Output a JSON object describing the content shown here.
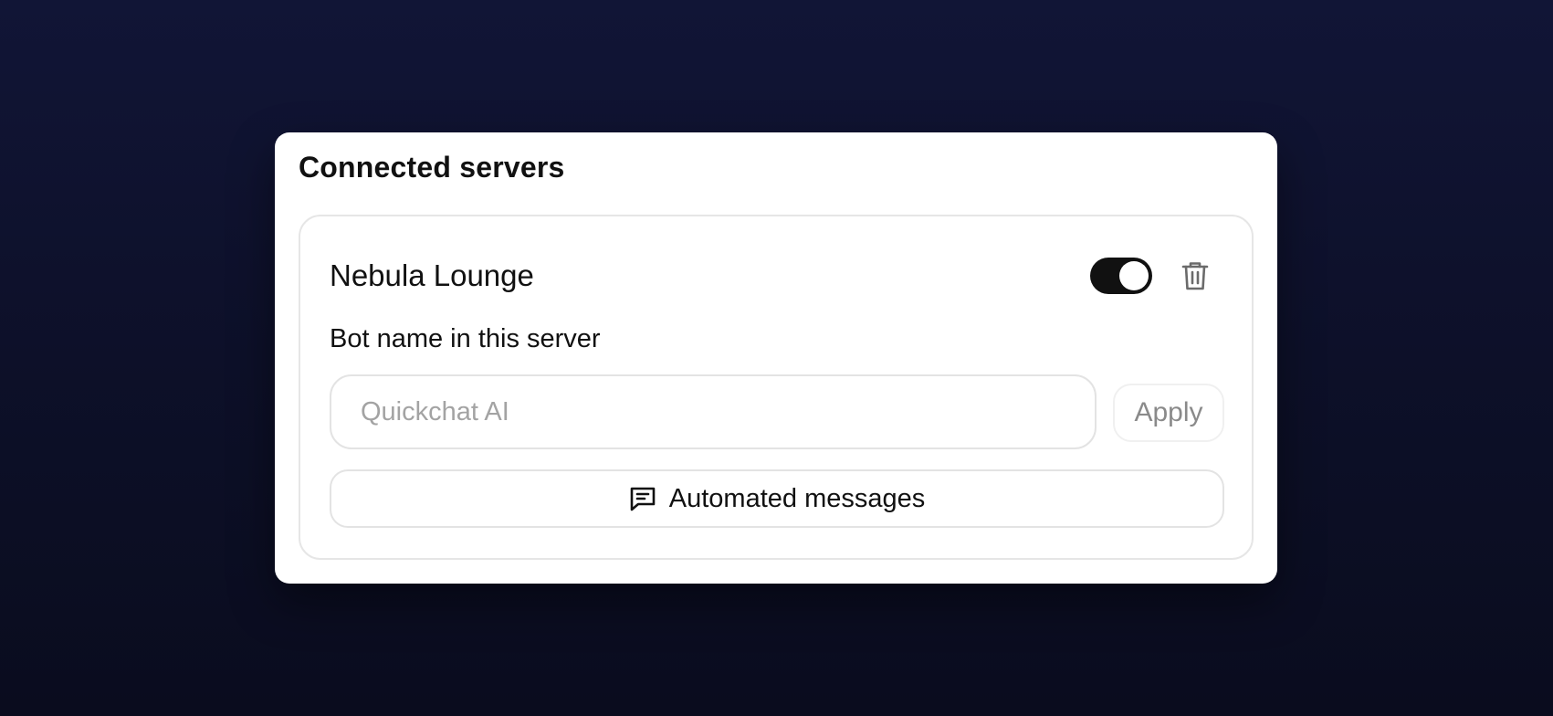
{
  "panel": {
    "title": "Connected servers"
  },
  "server": {
    "name": "Nebula Lounge",
    "enabled": true,
    "toggle_icon": "toggle-on",
    "delete_icon": "trash-icon",
    "bot_name_label": "Bot name in this server",
    "bot_name_value": "",
    "bot_name_placeholder": "Quickchat AI",
    "apply_label": "Apply",
    "automated_messages_label": "Automated messages",
    "automated_messages_icon": "message-square-icon"
  },
  "colors": {
    "background": "#0d1029",
    "panel": "#ffffff",
    "toggle_on": "#111111",
    "placeholder": "#a3a3a3",
    "muted_text": "#8a8a8a"
  }
}
